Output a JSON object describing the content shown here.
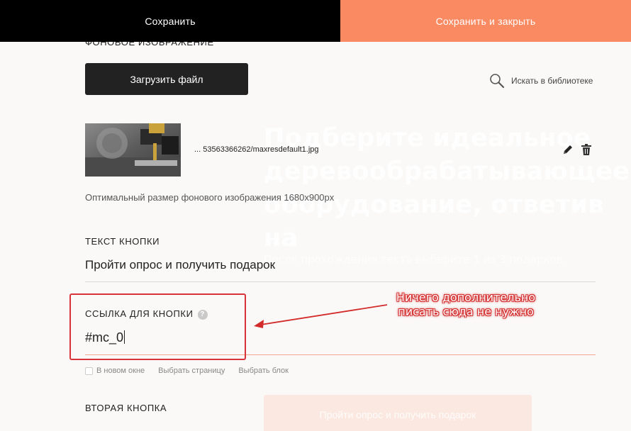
{
  "topbar": {
    "save_label": "Сохранить",
    "save_close_label": "Сохранить и закрыть"
  },
  "bg_image": {
    "section_label": "Фоновое изображение",
    "upload_label": "Загрузить файл",
    "library_label": "Искать в библиотеке",
    "library_icon": "magnifier-icon",
    "filename": "... 53563366262/maxresdefault1.jpg",
    "hint": "Оптимальный размер фонового изображения 1680x900px"
  },
  "button_text": {
    "label": "Текст кнопки",
    "value": "Пройти опрос и получить подарок"
  },
  "button_link": {
    "label": "Ссылка для кнопки",
    "help": "?",
    "value": "#mc_0",
    "new_window_label": "В новом окне",
    "choose_page_label": "Выбрать страницу",
    "choose_block_label": "Выбрать блок"
  },
  "second_button": {
    "label": "Вторая кнопка"
  },
  "annotation": {
    "line1": "Ничего дополнительно",
    "line2": "писать сюда не нужно"
  },
  "background_page": {
    "hero_lines": [
      "Подберите идеальное",
      "деревообрабатывающее",
      "оборудование, ответив на"
    ],
    "sub": "После прохождения теста выберите 1 из 3 подарков",
    "cta": "Пройти опрос и получить подарок"
  },
  "colors": {
    "accent": "#fa8a62",
    "dark": "#222222",
    "annotation": "#d32a2a",
    "link_underline": "#f0a890"
  }
}
